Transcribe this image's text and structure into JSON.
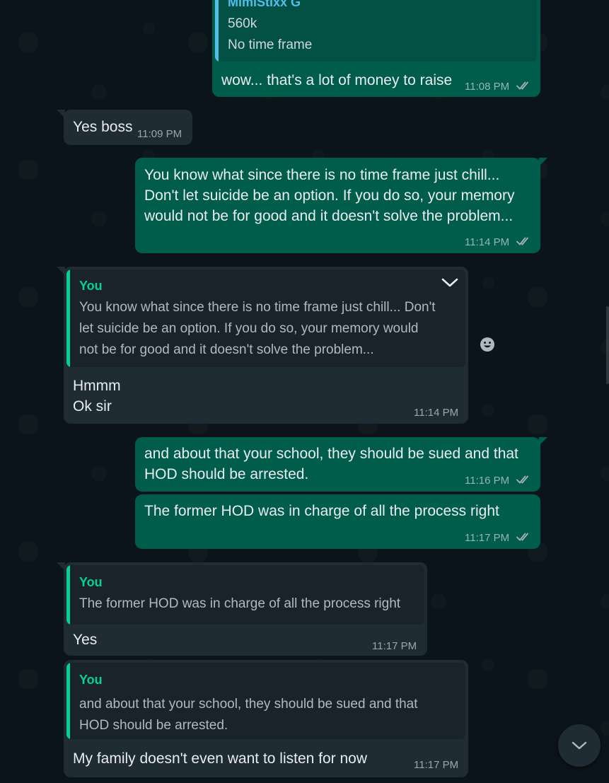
{
  "colors": {
    "outgoing_bubble": "#005c4b",
    "incoming_bubble": "#202c33",
    "quote_bar_contact": "#53bdeb",
    "quote_bar_you": "#06cf9c",
    "read_ticks": "#a6b0b6"
  },
  "messages": {
    "m1": {
      "quote_name": "MimiStixx G",
      "quote_line1": "560k",
      "quote_line2": "No time frame",
      "text": "wow... that's a lot of money to raise",
      "time": "11:08 PM"
    },
    "m2": {
      "text": "Yes boss",
      "time": "11:09 PM"
    },
    "m3": {
      "line1": "You know what since there is no time frame just chill...",
      "line2": "Don't let suicide be an option. If you do so, your memory",
      "line3": "would not be for good and it doesn't solve the problem...",
      "time": "11:14 PM"
    },
    "m4": {
      "quote_name": "You",
      "quote_line1": "You know what since there is no time frame just chill... Don't",
      "quote_line2": "let suicide be an option. If you do so, your memory would",
      "quote_line3": "not be for good and it doesn't solve the problem...",
      "line1": "Hmmm",
      "line2": "Ok sir",
      "time": "11:14 PM"
    },
    "m5": {
      "line1": "and about that your school, they should be sued and that",
      "line2": "HOD should be arrested.",
      "time": "11:16 PM"
    },
    "m6": {
      "text": "The former HOD was in charge of all the process right",
      "time": "11:17 PM"
    },
    "m7": {
      "quote_name": "You",
      "quote_line1": "The former HOD was in charge of all the process right",
      "text": "Yes",
      "time": "11:17 PM"
    },
    "m8": {
      "quote_name": "You",
      "quote_line1": "and about that your school, they should be sued and that",
      "quote_line2": "HOD should be arrested.",
      "text": "My family doesn't even want to listen for now",
      "time": "11:17 PM"
    }
  },
  "icons": {
    "menu": "chevron-down-icon",
    "react": "smiley-icon",
    "scroll_down": "chevron-down-icon",
    "read_status": "double-check-icon"
  }
}
